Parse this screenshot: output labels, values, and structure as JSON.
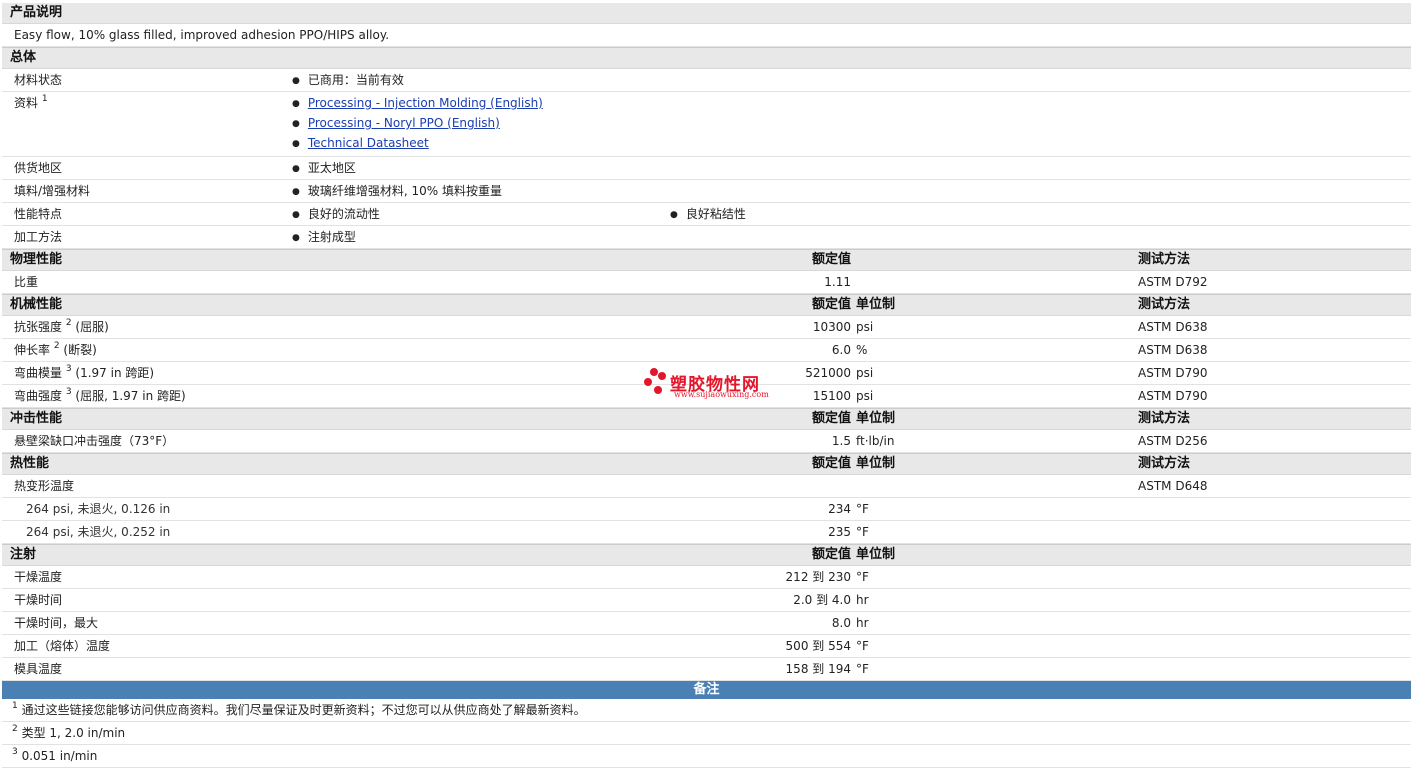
{
  "desc": {
    "title": "产品说明",
    "text": "Easy flow, 10% glass filled, improved adhesion PPO/HIPS alloy."
  },
  "general": {
    "title": "总体",
    "status_label": "材料状态",
    "status_value": "已商用：当前有效",
    "docs_label": "资料",
    "docs_sup": "1",
    "docs": [
      "Processing - Injection Molding (English)",
      "Processing - Noryl PPO (English)",
      "Technical Datasheet"
    ],
    "region_label": "供货地区",
    "region_value": "亚太地区",
    "filler_label": "填料/增强材料",
    "filler_value": "玻璃纤维增强材料, 10% 填料按重量",
    "features_label": "性能特点",
    "features": [
      "良好的流动性",
      "良好粘结性"
    ],
    "process_label": "加工方法",
    "process_value": "注射成型"
  },
  "headers": {
    "nominal": "额定值",
    "unit": "单位制",
    "test": "测试方法"
  },
  "physical": {
    "title": "物理性能",
    "rows": [
      {
        "label": "比重",
        "value": "1.11",
        "unit": "",
        "test": "ASTM D792"
      }
    ]
  },
  "mechanical": {
    "title": "机械性能",
    "rows": [
      {
        "label": "抗张强度",
        "sup": "2",
        "extra": " (屈服)",
        "value": "10300",
        "unit": "psi",
        "test": "ASTM D638"
      },
      {
        "label": "伸长率",
        "sup": "2",
        "extra": " (断裂)",
        "value": "6.0",
        "unit": "%",
        "test": "ASTM D638"
      },
      {
        "label": "弯曲模量",
        "sup": "3",
        "extra": " (1.97 in 跨距)",
        "value": "521000",
        "unit": "psi",
        "test": "ASTM D790"
      },
      {
        "label": "弯曲强度",
        "sup": "3",
        "extra": " (屈服, 1.97 in 跨距)",
        "value": "15100",
        "unit": "psi",
        "test": "ASTM D790"
      }
    ]
  },
  "impact": {
    "title": "冲击性能",
    "rows": [
      {
        "label": "悬壁梁缺口冲击强度（73°F）",
        "value": "1.5",
        "unit": "ft·lb/in",
        "test": "ASTM D256"
      }
    ]
  },
  "thermal": {
    "title": "热性能",
    "label": "热变形温度",
    "test": "ASTM D648",
    "rows": [
      {
        "label": "264 psi, 未退火, 0.126 in",
        "value": "234",
        "unit": "°F"
      },
      {
        "label": "264 psi, 未退火, 0.252 in",
        "value": "235",
        "unit": "°F"
      }
    ]
  },
  "injection": {
    "title": "注射",
    "rows": [
      {
        "label": "干燥温度",
        "value": "212 到  230",
        "unit": "°F"
      },
      {
        "label": "干燥时间",
        "value": "2.0 到  4.0",
        "unit": "hr"
      },
      {
        "label": "干燥时间，最大",
        "value": "8.0",
        "unit": "hr"
      },
      {
        "label": "加工（熔体）温度",
        "value": "500 到  554",
        "unit": "°F"
      },
      {
        "label": "模具温度",
        "value": "158 到  194",
        "unit": "°F"
      }
    ]
  },
  "notes": {
    "title": "备注",
    "items": [
      {
        "sup": "1",
        "text": "通过这些链接您能够访问供应商资料。我们尽量保证及时更新资料；不过您可以从供应商处了解最新资料。"
      },
      {
        "sup": "2",
        "text": "类型  1, 2.0 in/min"
      },
      {
        "sup": "3",
        "text": "0.051 in/min"
      }
    ]
  },
  "logo": {
    "name": "塑胶物性网",
    "url": "www.sujiaowuxing.com",
    "color": "#e4162b"
  }
}
